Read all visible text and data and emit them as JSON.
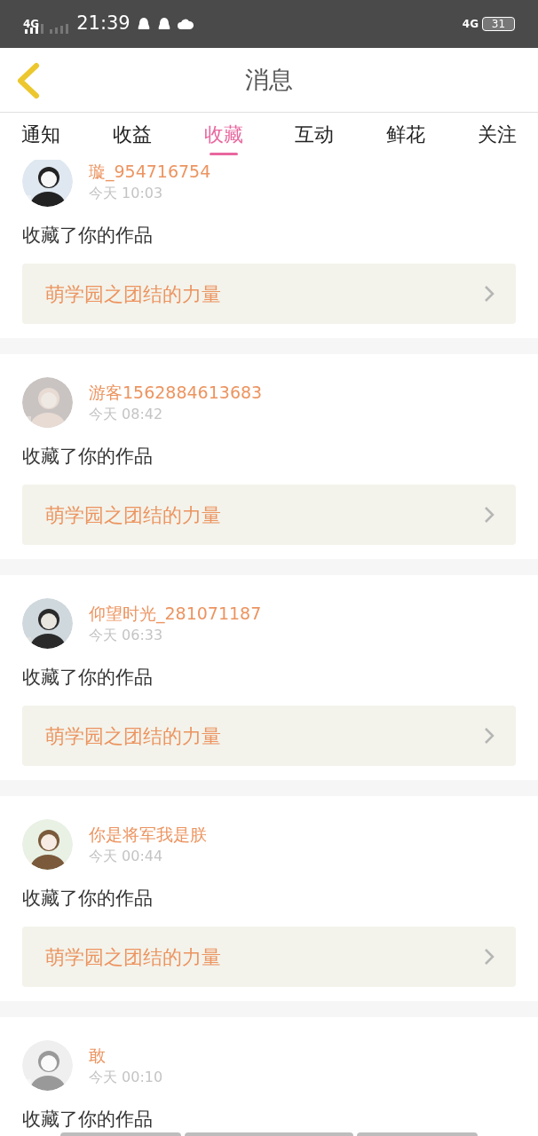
{
  "status_bar": {
    "network_left": "4G",
    "time": "21:39",
    "network_right": "4G",
    "battery": "31"
  },
  "header": {
    "title": "消息"
  },
  "tabs": [
    {
      "label": "通知",
      "selected": false
    },
    {
      "label": "收益",
      "selected": false
    },
    {
      "label": "收藏",
      "selected": true
    },
    {
      "label": "互动",
      "selected": false
    },
    {
      "label": "鲜花",
      "selected": false
    },
    {
      "label": "关注",
      "selected": false
    }
  ],
  "messages": [
    {
      "user": "璇_954716754",
      "time": "今天 10:03",
      "text": "收藏了你的作品",
      "work": "萌学园之团结的力量"
    },
    {
      "user": "游客1562884613683",
      "time": "今天 08:42",
      "text": "收藏了你的作品",
      "work": "萌学园之团结的力量"
    },
    {
      "user": "仰望时光_281071187",
      "time": "今天 06:33",
      "text": "收藏了你的作品",
      "work": "萌学园之团结的力量"
    },
    {
      "user": "你是将军我是朕",
      "time": "今天 00:44",
      "text": "收藏了你的作品",
      "work": "萌学园之团结的力量"
    },
    {
      "user": "敢",
      "time": "今天 00:10",
      "text": "收藏了你的作品"
    }
  ]
}
